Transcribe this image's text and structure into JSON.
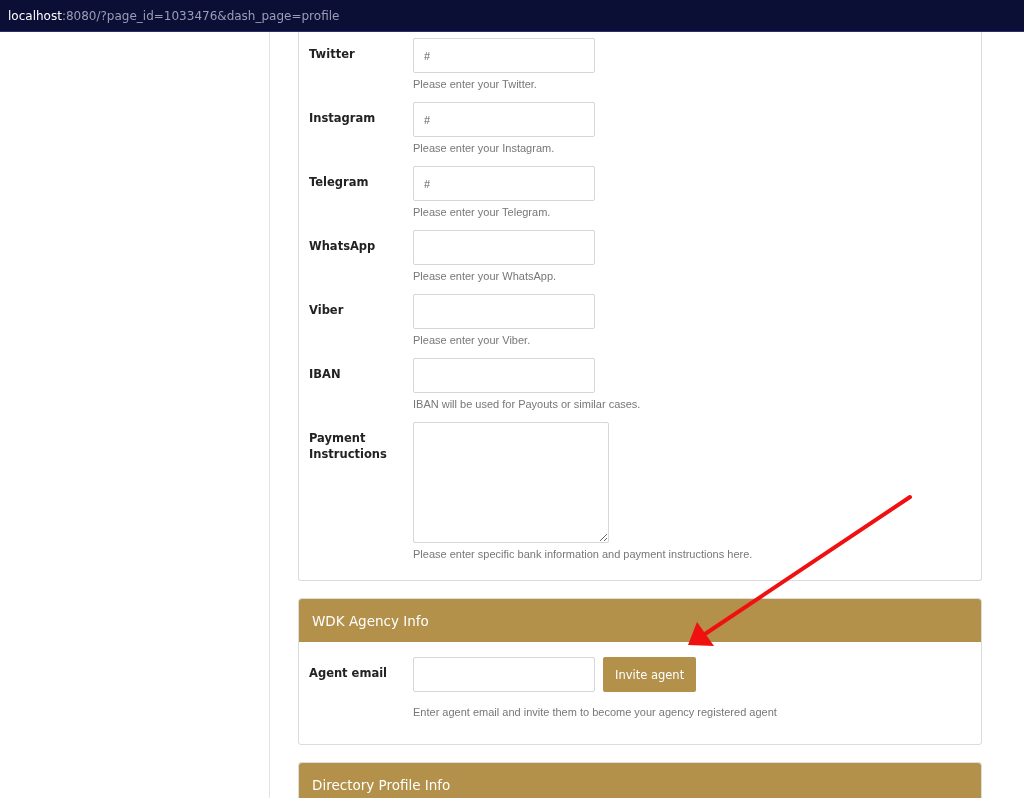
{
  "address_bar": {
    "host": "localhost",
    "path": ":8080/?page_id=1033476&dash_page=profile"
  },
  "profile_section": {
    "fields": [
      {
        "kind": "input",
        "label": "Twitter",
        "value": "#",
        "help": "Please enter your Twitter."
      },
      {
        "kind": "input",
        "label": "Instagram",
        "value": "#",
        "help": "Please enter your Instagram."
      },
      {
        "kind": "input",
        "label": "Telegram",
        "value": "#",
        "help": "Please enter your Telegram."
      },
      {
        "kind": "input",
        "label": "WhatsApp",
        "help": "Please enter your WhatsApp."
      },
      {
        "kind": "input",
        "label": "Viber",
        "help": "Please enter your Viber."
      },
      {
        "kind": "input",
        "label": "IBAN",
        "help": "IBAN will be used for Payouts or similar cases."
      },
      {
        "kind": "textarea",
        "label": "Payment Instructions",
        "help": "Please enter specific bank information and payment instructions here."
      }
    ]
  },
  "agency_section": {
    "title": "WDK Agency Info",
    "label": "Agent email",
    "button": "Invite agent",
    "help": "Enter agent email and invite them to become your agency registered agent"
  },
  "directory_section": {
    "title": "Directory Profile Info"
  }
}
